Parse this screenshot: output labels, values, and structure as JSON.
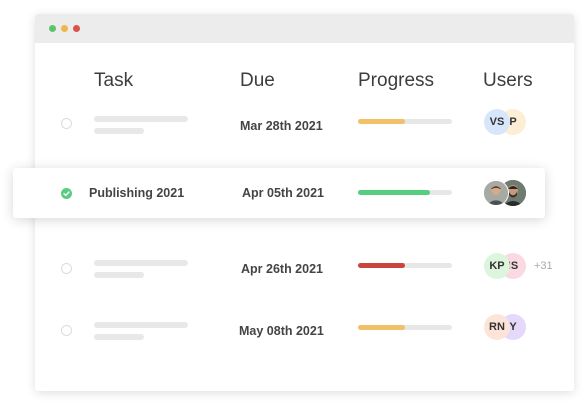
{
  "window": {
    "dots": [
      "#5ec46a",
      "#f0b649",
      "#d9534a"
    ]
  },
  "header": {
    "task": "Task",
    "due": "Due",
    "progress": "Progress",
    "users": "Users"
  },
  "rows": [
    {
      "due": "Mar 28th 2021",
      "progress": 0.5,
      "color": "#f1c16a",
      "avatars": [
        {
          "initials": "VS",
          "bg": "#d8e6fb"
        },
        {
          "initials": "P",
          "bg": "#fdefd6"
        }
      ]
    },
    {
      "task": "Publishing 2021",
      "due": "Apr 05th 2021",
      "progress": 0.77,
      "color": "#57cd7f",
      "avatars": [
        {
          "name": "user-photo-1"
        },
        {
          "name": "user-photo-2"
        }
      ]
    },
    {
      "due": "Apr 26th 2021",
      "progress": 0.5,
      "color": "#c9453d",
      "avatars": [
        {
          "initials": "KP",
          "bg": "#dcf5dc"
        },
        {
          "initials": "IS",
          "bg": "#fbd9e3"
        }
      ],
      "more": "+31"
    },
    {
      "due": "May 08th 2021",
      "progress": 0.5,
      "color": "#f1c16a",
      "avatars": [
        {
          "initials": "RN",
          "bg": "#fde4d8"
        },
        {
          "initials": "Y",
          "bg": "#e4d9fb"
        }
      ]
    }
  ],
  "icons": {
    "done_check": "check-circle-icon",
    "pending_check": "empty-check-icon"
  }
}
